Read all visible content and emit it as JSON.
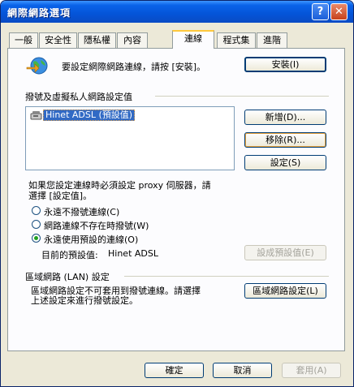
{
  "window": {
    "title": "網際網路選項",
    "help_glyph": "?",
    "close_glyph": "✕"
  },
  "tabs": [
    {
      "label": "一般"
    },
    {
      "label": "安全性"
    },
    {
      "label": "隱私權"
    },
    {
      "label": "內容"
    },
    {
      "label": "連線"
    },
    {
      "label": "程式集"
    },
    {
      "label": "進階"
    }
  ],
  "setup": {
    "text": "要設定網際網路連線，請按 [安裝]。",
    "button": "安裝(I)"
  },
  "dialup": {
    "group_label": "撥號及虛擬私人網路設定值",
    "connections": [
      {
        "name": "Hinet ADSL (預設值)"
      }
    ],
    "add_button": "新增(D)...",
    "remove_button": "移除(R)...",
    "settings_button": "設定(S)"
  },
  "proxy_note_line1": "如果您設定連線時必須設定 proxy 伺服器，請",
  "proxy_note_line2": "選擇 [設定值]。",
  "radios": [
    {
      "label": "永遠不撥號連線(C)",
      "checked": false
    },
    {
      "label": "網路連線不存在時撥號(W)",
      "checked": false
    },
    {
      "label": "永遠使用預設的連線(O)",
      "checked": true
    }
  ],
  "default_conn": {
    "label": "目前的預設值:",
    "value": "Hinet ADSL",
    "button": "設成預設值(E)"
  },
  "lan": {
    "group_label": "區域網路 (LAN) 設定",
    "text_line1": "區域網路設定不可套用到撥號連線。請選擇",
    "text_line2": "上述設定來進行撥號設定。",
    "button": "區域網路設定(L)"
  },
  "footer": {
    "ok": "確定",
    "cancel": "取消",
    "apply": "套用(A)"
  },
  "colors": {
    "titlebar": "#0454d8",
    "face": "#ece9d8",
    "tab_highlight": "#ffc83c",
    "selection": "#316ac5"
  }
}
